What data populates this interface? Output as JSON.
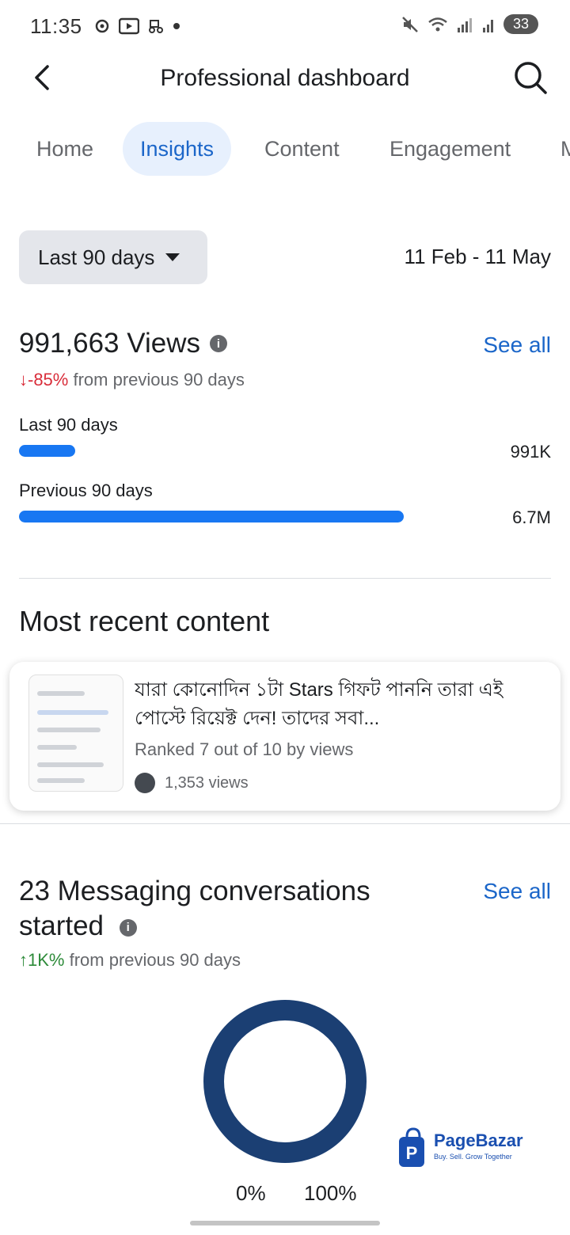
{
  "status_bar": {
    "time": "11:35",
    "battery": "33"
  },
  "header": {
    "title": "Professional dashboard"
  },
  "tabs": [
    {
      "label": "Home"
    },
    {
      "label": "Insights"
    },
    {
      "label": "Content"
    },
    {
      "label": "Engagement"
    },
    {
      "label": "M"
    }
  ],
  "date_range": {
    "selected": "Last 90 days",
    "dates": "11 Feb - 11 May"
  },
  "views": {
    "title": "991,663 Views",
    "see_all": "See all",
    "change": "↓-85%",
    "change_suffix": " from previous 90 days",
    "bars": [
      {
        "label": "Last 90 days",
        "value": "991K",
        "fraction": 0.119
      },
      {
        "label": "Previous 90 days",
        "value": "6.7M",
        "fraction": 0.81
      }
    ]
  },
  "recent_content": {
    "title": "Most recent content",
    "post": {
      "title": "যারা কোনোদিন ১টা Stars গিফট পাননি তারা এই পোস্টে রিয়েক্ট দেন! তাদের সবা...",
      "rank": "Ranked 7 out of 10 by views",
      "views": "1,353 views"
    }
  },
  "messaging": {
    "title": "23 Messaging conversations started",
    "see_all": "See all",
    "change": "↑1K%",
    "change_suffix": " from previous 90 days",
    "donut": {
      "label_left": "0%",
      "label_right": "100%",
      "color": "#1b3f73"
    }
  },
  "logo": {
    "name": "PageBazar",
    "tagline": "Buy. Sell. Grow Together"
  },
  "colors": {
    "accent": "#1b66c9",
    "bar": "#1877f2",
    "negative": "#d92d3a",
    "positive": "#2e8b3a"
  }
}
